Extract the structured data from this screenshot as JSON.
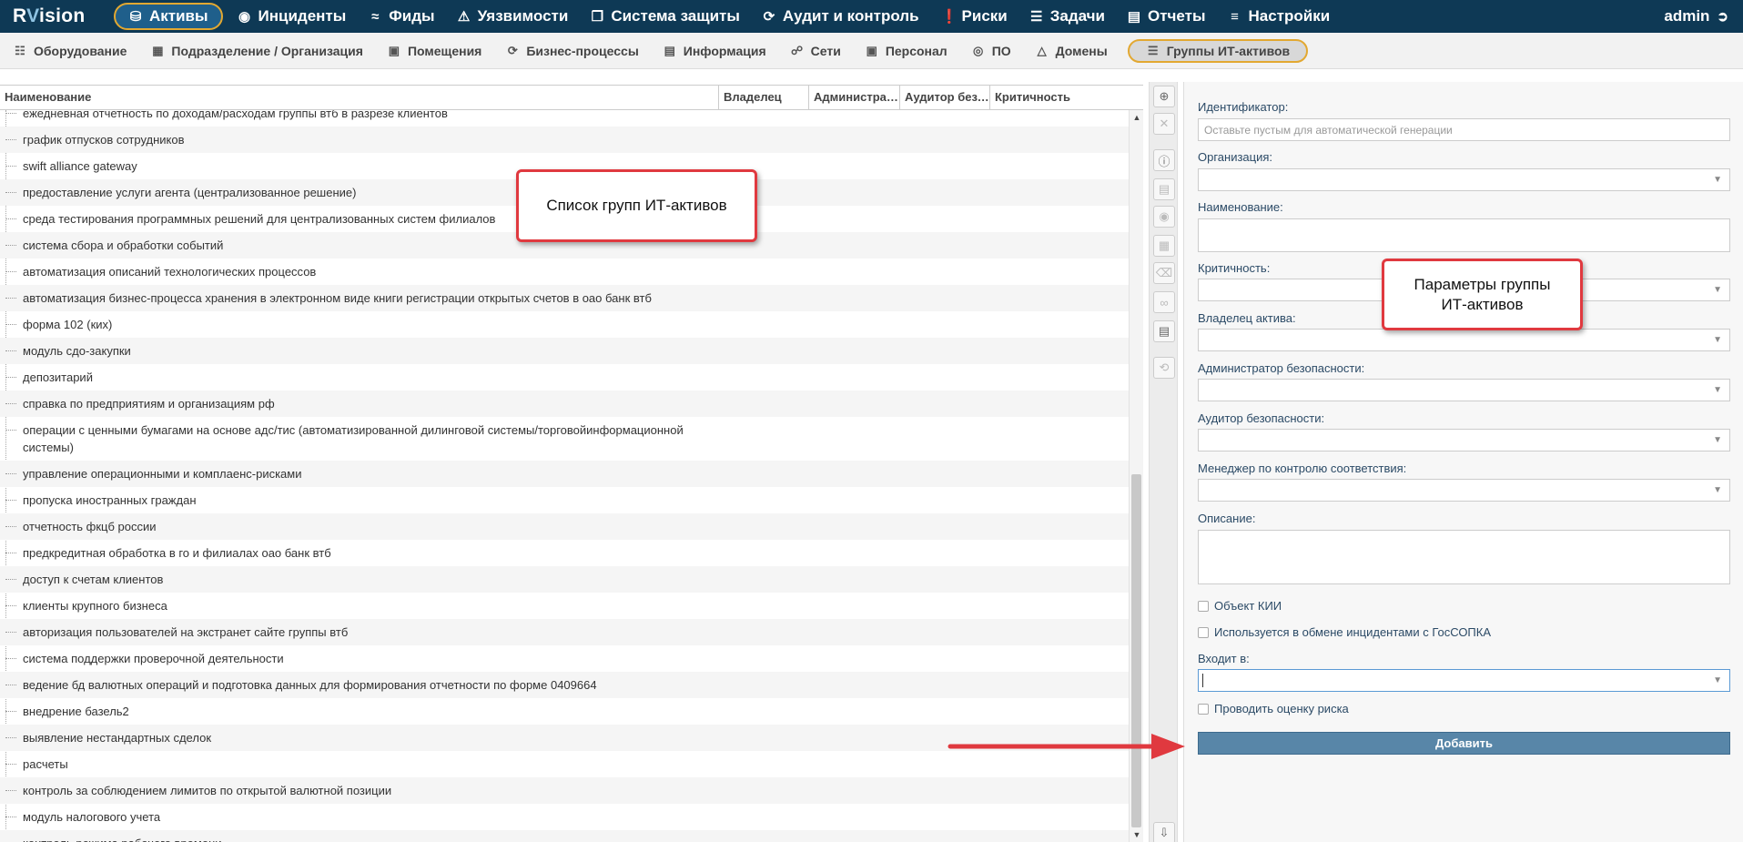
{
  "app": {
    "logo_r": "R",
    "logo_v": "V",
    "logo_rest": "ision"
  },
  "topnav": {
    "items": [
      {
        "label": "Активы",
        "icon": "database-icon"
      },
      {
        "label": "Инциденты",
        "icon": "target-icon"
      },
      {
        "label": "Фиды",
        "icon": "rss-icon"
      },
      {
        "label": "Уязвимости",
        "icon": "warning-icon"
      },
      {
        "label": "Система защиты",
        "icon": "windows-icon"
      },
      {
        "label": "Аудит и контроль",
        "icon": "cycle-icon"
      },
      {
        "label": "Риски",
        "icon": "exclamation-icon"
      },
      {
        "label": "Задачи",
        "icon": "list-icon"
      },
      {
        "label": "Отчеты",
        "icon": "report-icon"
      },
      {
        "label": "Настройки",
        "icon": "menu-icon"
      }
    ],
    "user": "admin"
  },
  "subnav": {
    "items": [
      {
        "label": "Оборудование"
      },
      {
        "label": "Подразделение / Организация"
      },
      {
        "label": "Помещения"
      },
      {
        "label": "Бизнес-процессы"
      },
      {
        "label": "Информация"
      },
      {
        "label": "Сети"
      },
      {
        "label": "Персонал"
      },
      {
        "label": "ПО"
      },
      {
        "label": "Домены"
      },
      {
        "label": "Группы ИТ-активов"
      }
    ]
  },
  "table": {
    "columns": [
      "Наименование",
      "Владелец",
      "Администратор безопасности",
      "Аудитор безопасности",
      "Критичность"
    ],
    "rows": [
      "ежедневная отчетность по доходам/расходам группы втб в разрезе клиентов",
      "график отпусков сотрудников",
      "swift alliance gateway",
      "предоставление услуги агента (централизованное решение)",
      "среда тестирования программных решений для централизованных систем филиалов",
      "система сбора и обработки событий",
      "автоматизация описаний технологических процессов",
      "автоматизация бизнес-процесса хранения в электронном виде книги регистрации открытых счетов в оао банк втб",
      "форма 102 (ких)",
      "модуль сдо-закупки",
      "депозитарий",
      "справка по предприятиям и организациям рф",
      "операции с ценными бумагами на основе адс/тис (автоматизированной дилинговой системы/торговойинформационной системы)",
      "управление операционными и комплаенс-рисками",
      "пропуска иностранных граждан",
      "отчетность фкцб россии",
      "предкредитная обработка в го и филиалах оао банк втб",
      "доступ к счетам клиентов",
      "клиенты крупного бизнеса",
      "авторизация пользователей на экстранет сайте группы втб",
      "система поддержки проверочной деятельности",
      "ведение бд валютных операций и подготовка данных для формирования отчетности по форме 0409664",
      "внедрение базель2",
      "выявление нестандартных сделок",
      "расчеты",
      "контроль за соблюдением лимитов по открытой валютной позиции",
      "модуль налогового учета",
      "контроль режима рабочего времени"
    ]
  },
  "form": {
    "id_label": "Идентификатор:",
    "id_placeholder": "Оставьте пустым для автоматической генерации",
    "org_label": "Организация:",
    "name_label": "Наименование:",
    "crit_label": "Критичность:",
    "owner_label": "Владелец актива:",
    "admin_label": "Администратор безопасности:",
    "auditor_label": "Аудитор безопасности:",
    "manager_label": "Менеджер по контролю соответствия:",
    "desc_label": "Описание:",
    "kii_label": "Объект КИИ",
    "gossopka_label": "Используется в обмене инцидентами с ГосСОПКА",
    "member_label": "Входит в:",
    "risk_label": "Проводить оценку риска",
    "add_button": "Добавить"
  },
  "annotations": {
    "list_callout": "Список групп ИТ-активов",
    "params_callout_1": "Параметры группы",
    "params_callout_2": "ИТ-активов"
  },
  "colors": {
    "topnav_bg": "#0e3955",
    "highlight": "#e2a831",
    "callout_border": "#e0393f",
    "add_button_bg": "#5886a8"
  }
}
